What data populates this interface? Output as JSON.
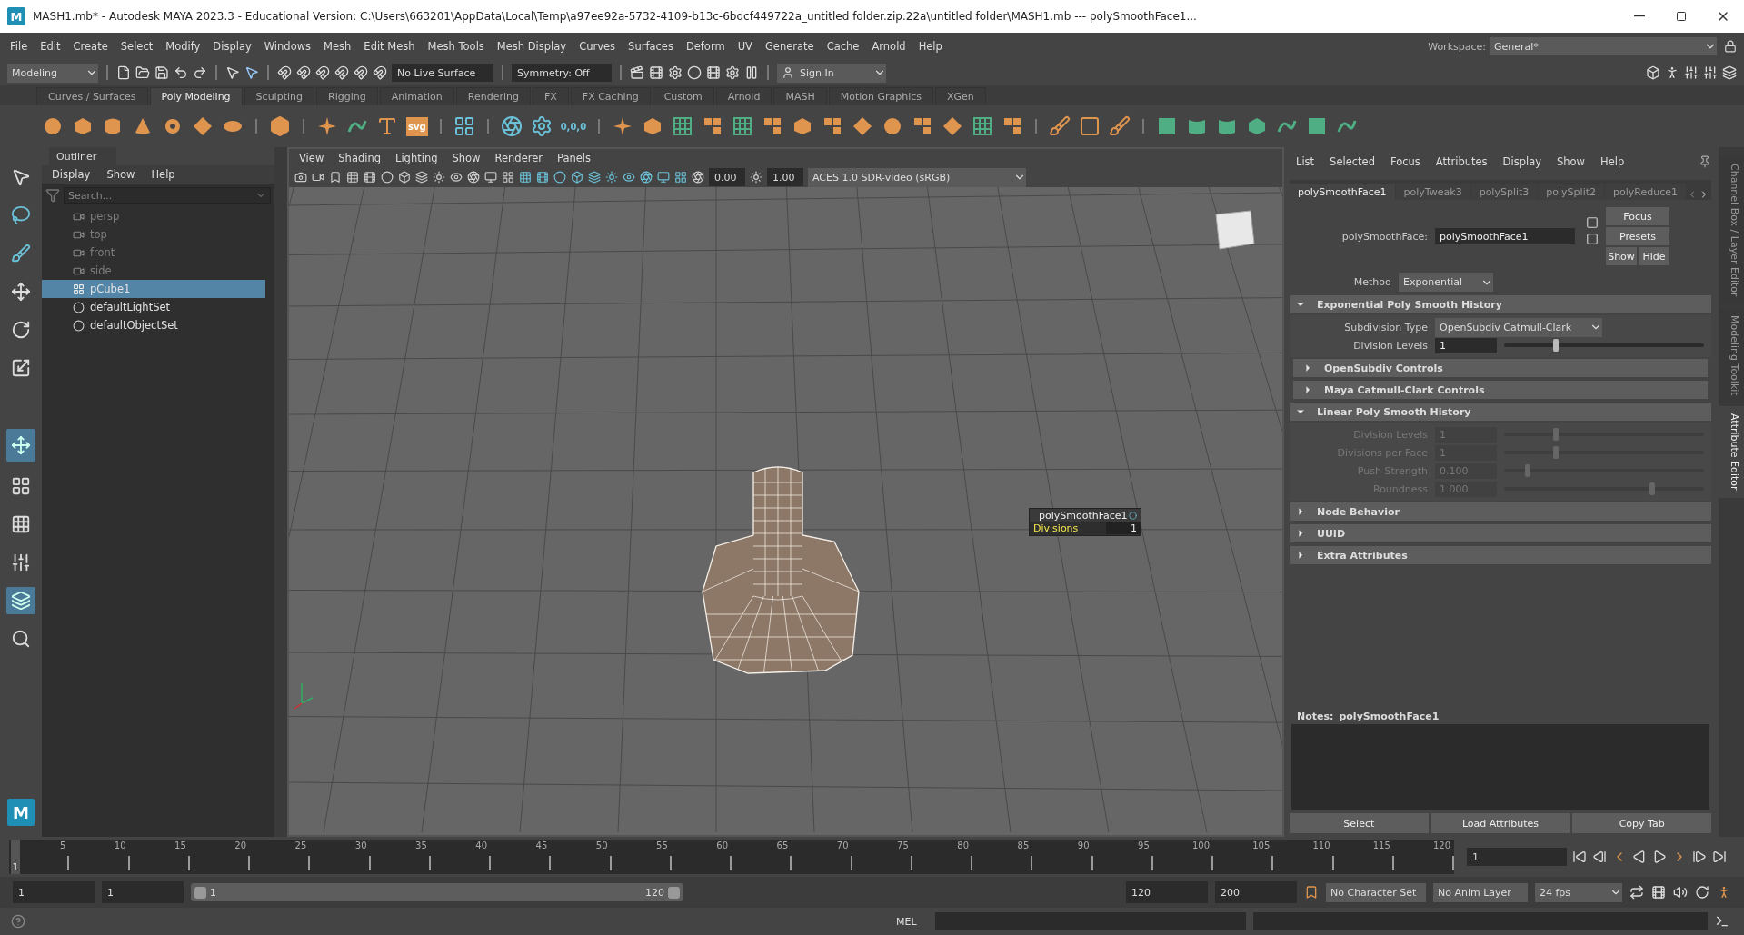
{
  "window": {
    "logo": "M",
    "title": "MASH1.mb* - Autodesk MAYA 2023.3 - Educational Version: C:\\Users\\663201\\AppData\\Local\\Temp\\a97ee92a-5732-4109-b13c-6bdcf449722a_untitled folder.zip.22a\\untitled folder\\MASH1.mb   ---   polySmoothFace1..."
  },
  "menu_bar": [
    "File",
    "Edit",
    "Create",
    "Select",
    "Modify",
    "Display",
    "Windows",
    "Mesh",
    "Edit Mesh",
    "Mesh Tools",
    "Mesh Display",
    "Curves",
    "Surfaces",
    "Deform",
    "UV",
    "Generate",
    "Cache",
    "Arnold",
    "Help"
  ],
  "workspace": {
    "label": "Workspace:",
    "value": "General*"
  },
  "status_line": {
    "mode": "Modeling",
    "live_surface": "No Live Surface",
    "symmetry": "Symmetry: Off",
    "sign_in": "Sign In"
  },
  "shelf": {
    "tabs": [
      {
        "label": "Curves / Surfaces",
        "selected": false
      },
      {
        "label": "Poly Modeling",
        "selected": true
      },
      {
        "label": "Sculpting",
        "selected": false
      },
      {
        "label": "Rigging",
        "selected": false
      },
      {
        "label": "Animation",
        "selected": false
      },
      {
        "label": "Rendering",
        "selected": false
      },
      {
        "label": "FX",
        "selected": false
      },
      {
        "label": "FX Caching",
        "selected": false
      },
      {
        "label": "Custom",
        "selected": false
      },
      {
        "label": "Arnold",
        "selected": false
      },
      {
        "label": "MASH",
        "selected": false
      },
      {
        "label": "Motion Graphics",
        "selected": false
      },
      {
        "label": "XGen",
        "selected": false
      }
    ],
    "svg_label": "svg",
    "zero_label": "0,0,0"
  },
  "toolbox": {
    "logo": "M"
  },
  "outliner": {
    "title": "Outliner",
    "menu": [
      "Display",
      "Show",
      "Help"
    ],
    "search_placeholder": "Search...",
    "items": [
      {
        "label": "persp",
        "kind": "camera",
        "dimmed": true,
        "selected": false
      },
      {
        "label": "top",
        "kind": "camera",
        "dimmed": true,
        "selected": false
      },
      {
        "label": "front",
        "kind": "camera",
        "dimmed": true,
        "selected": false
      },
      {
        "label": "side",
        "kind": "camera",
        "dimmed": true,
        "selected": false
      },
      {
        "label": "pCube1",
        "kind": "mesh",
        "dimmed": false,
        "selected": true
      },
      {
        "label": "defaultLightSet",
        "kind": "set",
        "dimmed": false,
        "selected": false
      },
      {
        "label": "defaultObjectSet",
        "kind": "set",
        "dimmed": false,
        "selected": false
      }
    ]
  },
  "viewport": {
    "menu": [
      "View",
      "Shading",
      "Lighting",
      "Show",
      "Renderer",
      "Panels"
    ],
    "exposure": "0.00",
    "gamma": "1.00",
    "color_space": "ACES 1.0 SDR-video (sRGB)",
    "hud": {
      "title": "polySmoothFace1",
      "label": "Divisions",
      "value": "1"
    }
  },
  "attribute_editor": {
    "menu": [
      "List",
      "Selected",
      "Focus",
      "Attributes",
      "Display",
      "Show",
      "Help"
    ],
    "tabs": [
      {
        "label": "polySmoothFace1",
        "selected": true
      },
      {
        "label": "polyTweak3",
        "selected": false
      },
      {
        "label": "polySplit3",
        "selected": false
      },
      {
        "label": "polySplit2",
        "selected": false
      },
      {
        "label": "polyReduce1",
        "selected": false
      }
    ],
    "node_label": "polySmoothFace:",
    "node_name": "polySmoothFace1",
    "buttons": [
      "Focus",
      "Presets",
      "Show",
      "Hide"
    ],
    "method_label": "Method",
    "method": "Exponential",
    "sections": [
      {
        "title": "Exponential Poly Smooth History",
        "expanded": true,
        "inset": false,
        "rows": [
          {
            "kind": "dropdown",
            "label": "Subdivision Type",
            "value": "OpenSubdiv Catmull-Clark",
            "disabled": false
          },
          {
            "kind": "slider",
            "label": "Division Levels",
            "value": "1",
            "level": 0.26,
            "disabled": false
          }
        ]
      },
      {
        "title": "OpenSubdiv Controls",
        "expanded": false,
        "inset": true
      },
      {
        "title": "Maya Catmull-Clark Controls",
        "expanded": false,
        "inset": true
      },
      {
        "title": "Linear Poly Smooth History",
        "expanded": true,
        "inset": false,
        "rows": [
          {
            "kind": "slider",
            "label": "Division Levels",
            "value": "1",
            "level": 0.26,
            "disabled": true
          },
          {
            "kind": "slider",
            "label": "Divisions per Face",
            "value": "1",
            "level": 0.26,
            "disabled": true
          },
          {
            "kind": "slider",
            "label": "Push Strength",
            "value": "0.100",
            "level": 0.12,
            "disabled": true
          },
          {
            "kind": "slider",
            "label": "Roundness",
            "value": "1.000",
            "level": 0.74,
            "disabled": true
          }
        ]
      },
      {
        "title": "Node Behavior",
        "expanded": false,
        "inset": false
      },
      {
        "title": "UUID",
        "expanded": false,
        "inset": false
      },
      {
        "title": "Extra Attributes",
        "expanded": false,
        "inset": false
      }
    ],
    "notes_label": "Notes:",
    "notes_node": "polySmoothFace1",
    "bottom_buttons": [
      "Select",
      "Load Attributes",
      "Copy Tab"
    ]
  },
  "side_tabs": [
    {
      "label": "Channel Box / Layer Editor",
      "selected": false
    },
    {
      "label": "Modeling Toolkit",
      "selected": false
    },
    {
      "label": "Attribute Editor",
      "selected": true
    }
  ],
  "timeline": {
    "current": "1",
    "level": 0,
    "ticks": [
      "5",
      "10",
      "15",
      "20",
      "25",
      "30",
      "35",
      "40",
      "45",
      "50",
      "55",
      "60",
      "65",
      "70",
      "75",
      "80",
      "85",
      "90",
      "95",
      "100",
      "105",
      "110",
      "115",
      "120"
    ],
    "current_field": "1"
  },
  "range": {
    "start": "1",
    "playback_start": "1",
    "slider_start": "1",
    "slider_end": "120",
    "level": 1,
    "playback_end": "120",
    "end": "200",
    "character_set": "No Character Set",
    "anim_layer": "No Anim Layer",
    "fps": "24 fps"
  },
  "command_line": {
    "label": "MEL"
  }
}
